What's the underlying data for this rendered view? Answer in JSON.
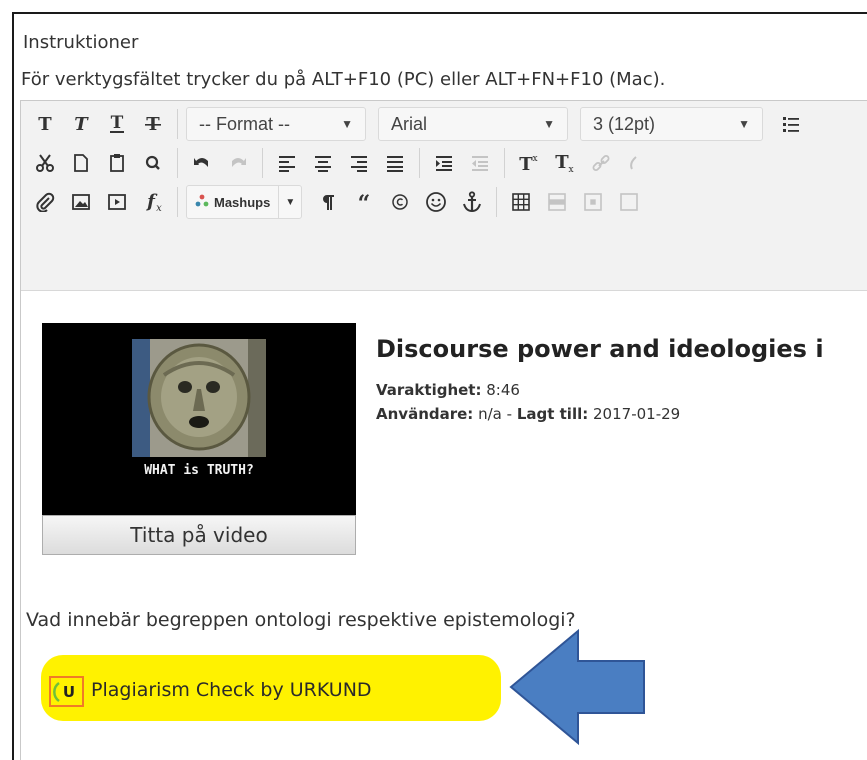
{
  "labels": {
    "instructions": "Instruktioner",
    "toolbar_hint": "För verktygsfältet trycker du på ALT+F10 (PC) eller ALT+FN+F10 (Mac)."
  },
  "toolbar": {
    "format_select": "-- Format --",
    "font_select": "Arial",
    "size_select": "3 (12pt)",
    "mashups_label": "Mashups"
  },
  "video": {
    "thumbnail_caption": "WHAT is TRUTH?",
    "watch_button": "Titta på video",
    "title": "Discourse power and ideologies i",
    "duration_label": "Varaktighet:",
    "duration_value": "8:46",
    "user_label": "Användare:",
    "user_value": "n/a",
    "separator": "-",
    "added_label": "Lagt till:",
    "added_value": "2017-01-29"
  },
  "body": {
    "question": "Vad innebär begreppen ontologi respektive epistemologi?"
  },
  "urkund": {
    "icon_letter": "U",
    "link_text": "Plagiarism Check by URKUND"
  },
  "colors": {
    "highlight": "#fff200",
    "arrow_fill": "#4a7ec2",
    "arrow_stroke": "#2f5597",
    "urkund_icon_border": "#f07b27"
  },
  "icons": [
    "bold-icon",
    "italic-icon",
    "underline-icon",
    "strikethrough-icon",
    "list-icon",
    "cut-icon",
    "copy-icon",
    "paste-icon",
    "find-icon",
    "undo-icon",
    "redo-icon",
    "align-left-icon",
    "align-center-icon",
    "align-right-icon",
    "justify-icon",
    "indent-icon",
    "outdent-icon",
    "superscript-icon",
    "subscript-icon",
    "link-icon",
    "unlink-icon",
    "attach-icon",
    "image-icon",
    "media-icon",
    "formula-icon",
    "mashups-icon",
    "paragraph-icon",
    "quote-icon",
    "copyright-icon",
    "emoticon-icon",
    "anchor-icon",
    "table-icon",
    "urkund-logo-icon",
    "arrow-pointer-icon"
  ]
}
